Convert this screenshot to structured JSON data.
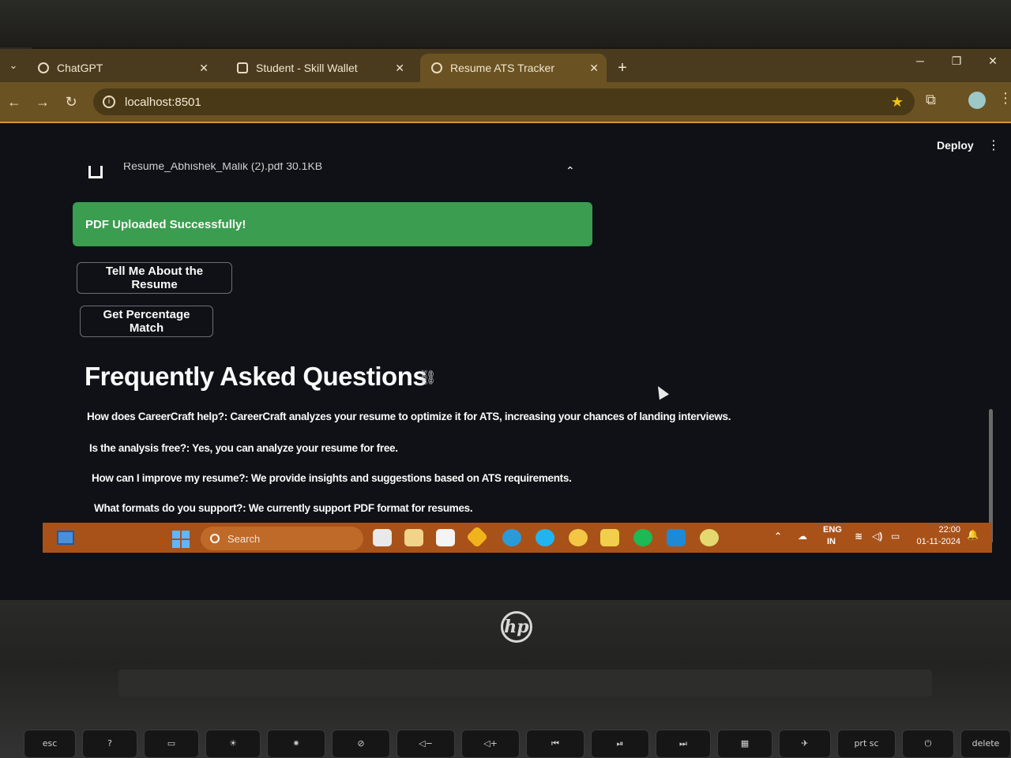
{
  "browser": {
    "tabs": [
      {
        "label": "ChatGPT"
      },
      {
        "label": "Student - Skill Wallet"
      },
      {
        "label": "Resume ATS Tracker"
      }
    ],
    "url": "localhost:8501"
  },
  "app": {
    "header": {
      "deploy_label": "Deploy"
    },
    "uploader": {
      "file_label": "Resume_Abhishek_Malik (2).pdf  30.1KB"
    },
    "success_message": "PDF Uploaded Successfully!",
    "buttons": {
      "about_resume": "Tell Me About the Resume",
      "percentage_match": "Get Percentage Match"
    },
    "faq": {
      "title": "Frequently Asked Questions",
      "items": [
        {
          "text": "How does CareerCraft help?: CareerCraft analyzes your resume to optimize it for ATS, increasing your chances of landing interviews."
        },
        {
          "text": "Is the analysis free?: Yes, you can analyze your resume for free."
        },
        {
          "text": "How can I improve my resume?: We provide insights and suggestions based on ATS requirements."
        },
        {
          "text": "What formats do you support?: We currently support PDF format for resumes."
        }
      ]
    }
  },
  "taskbar": {
    "search_placeholder": "Search",
    "language": "ENG",
    "region": "IN",
    "time": "22:00",
    "date": "01-11-2024"
  },
  "keyboard": {
    "esc": "esc",
    "prtsc": "prt sc",
    "delete": "delete"
  },
  "colors": {
    "success_bg": "#3a9d4f",
    "tab_bar": "#4a3b1f",
    "toolbar": "#6b5222",
    "app_bg": "#0f1116",
    "star": "#f1c40f"
  }
}
